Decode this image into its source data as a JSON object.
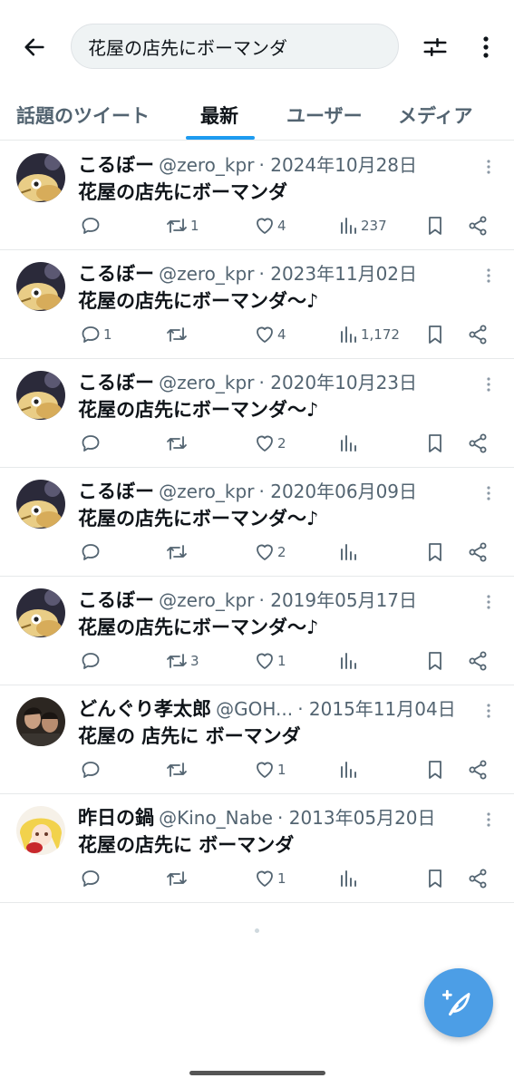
{
  "search": {
    "query": "花屋の店先にボーマンダ"
  },
  "tabs": [
    {
      "label": "話題のツイート"
    },
    {
      "label": "最新"
    },
    {
      "label": "ユーザー"
    },
    {
      "label": "メディア"
    }
  ],
  "active_tab": "最新",
  "icons": {
    "back": "arrow-left-icon",
    "filter": "sliders-icon",
    "more": "more-vertical-icon",
    "compose": "feather-plus-icon"
  },
  "colors": {
    "accent": "#1d9bf0",
    "fab": "#4c9ee6",
    "muted": "#536471"
  },
  "tweets": [
    {
      "name": "こるぼー",
      "handle": "@zero_kpr",
      "sep": "·",
      "date": "2024年10月28日",
      "text": "花屋の店先にボーマンダ",
      "replies": "",
      "retweets": "1",
      "likes": "4",
      "views": "237",
      "avatar": "dragon"
    },
    {
      "name": "こるぼー",
      "handle": "@zero_kpr",
      "sep": "·",
      "date": "2023年11月02日",
      "text": "花屋の店先にボーマンダ～♪",
      "replies": "1",
      "retweets": "",
      "likes": "4",
      "views": "1,172",
      "avatar": "dragon"
    },
    {
      "name": "こるぼー",
      "handle": "@zero_kpr",
      "sep": "·",
      "date": "2020年10月23日",
      "text": "花屋の店先にボーマンダ～♪",
      "replies": "",
      "retweets": "",
      "likes": "2",
      "views": "",
      "avatar": "dragon"
    },
    {
      "name": "こるぼー",
      "handle": "@zero_kpr",
      "sep": "·",
      "date": "2020年06月09日",
      "text": "花屋の店先にボーマンダ～♪",
      "replies": "",
      "retweets": "",
      "likes": "2",
      "views": "",
      "avatar": "dragon"
    },
    {
      "name": "こるぼー",
      "handle": "@zero_kpr",
      "sep": "·",
      "date": "2019年05月17日",
      "text": "花屋の店先にボーマンダ～♪",
      "replies": "",
      "retweets": "3",
      "likes": "1",
      "views": "",
      "avatar": "dragon"
    },
    {
      "name": "どんぐり孝太郎",
      "handle": "@GOH...",
      "sep": "·",
      "date": "2015年11月04日",
      "text": "花屋の 店先に ボーマンダ",
      "replies": "",
      "retweets": "",
      "likes": "1",
      "views": "",
      "avatar": "people"
    },
    {
      "name": "昨日の鍋",
      "handle": "@Kino_Nabe",
      "sep": "·",
      "date": "2013年05月20日",
      "text": "花屋の店先に ボーマンダ",
      "replies": "",
      "retweets": "",
      "likes": "1",
      "views": "",
      "avatar": "anime"
    }
  ]
}
